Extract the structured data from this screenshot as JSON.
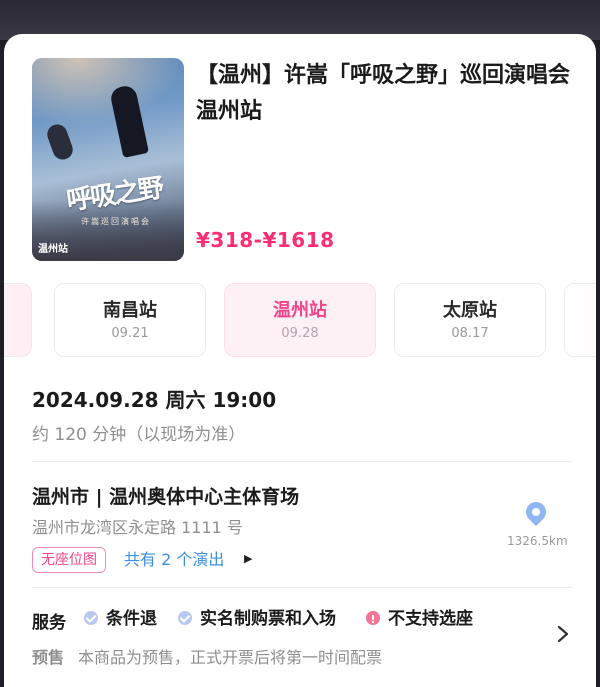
{
  "event": {
    "title": "【温州】许嵩「呼吸之野」巡回演唱会 温州站",
    "price": "¥318-¥1618",
    "poster": {
      "title_art": "呼吸之野",
      "subtitle": "许嵩巡回演唱会",
      "city": "温州站"
    }
  },
  "stations": [
    {
      "name": "",
      "date": ""
    },
    {
      "name": "南昌站",
      "date": "09.21"
    },
    {
      "name": "温州站",
      "date": "09.28"
    },
    {
      "name": "太原站",
      "date": "08.17"
    },
    {
      "name": "",
      "date": ""
    }
  ],
  "selected_station": "温州站",
  "schedule": {
    "datetime": "2024.09.28 周六 19:00",
    "duration": "约 120 分钟（以现场为准）"
  },
  "venue": {
    "name": "温州市 | 温州奥体中心主体育场",
    "address": "温州市龙湾区永定路 1111 号",
    "distance": "1326.5km",
    "seat_tag": "无座位图",
    "shows_link": "共有 2 个演出",
    "shows_arrow": "▶"
  },
  "services": {
    "label": "服务",
    "items": [
      {
        "text": "条件退",
        "status": "ok"
      },
      {
        "text": "实名制购票和入场",
        "status": "ok"
      },
      {
        "text": "不支持选座",
        "status": "warning"
      }
    ],
    "presale_label": "预售",
    "presale_text": "本商品为预售，正式开票后将第一时间配票"
  },
  "colors": {
    "accent_pink": "#ff2d76",
    "link_blue": "#3d8fe0",
    "active_station_bg": "#fdf1f6"
  }
}
